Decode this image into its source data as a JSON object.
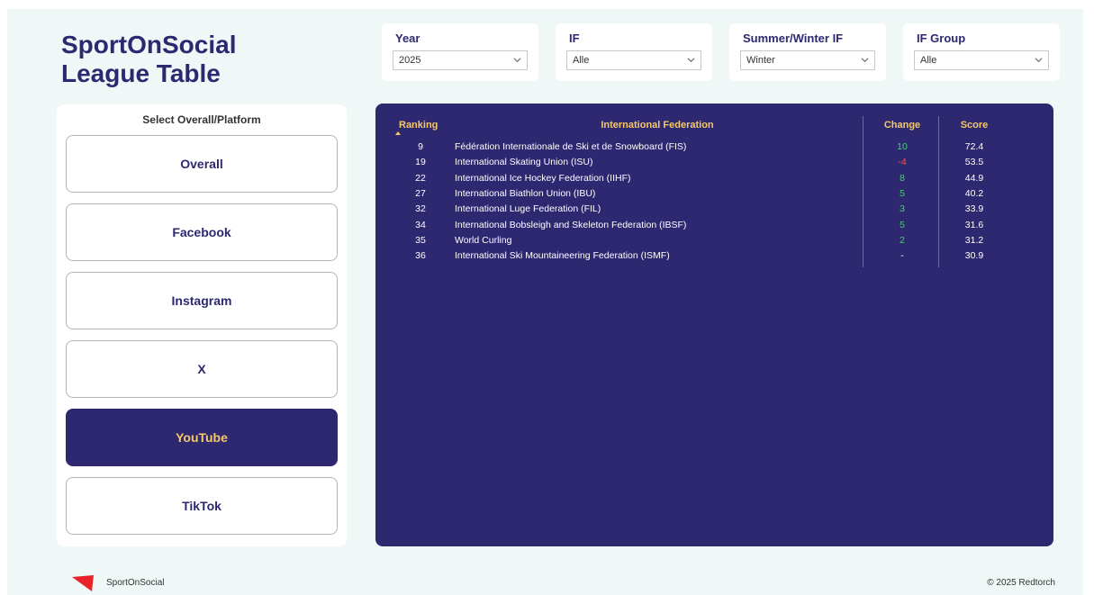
{
  "title": {
    "line1": "SportOnSocial",
    "line2": "League Table"
  },
  "filters": [
    {
      "label": "Year",
      "value": "2025"
    },
    {
      "label": "IF",
      "value": "Alle"
    },
    {
      "label": "Summer/Winter IF",
      "value": "Winter"
    },
    {
      "label": "IF Group",
      "value": "Alle"
    }
  ],
  "platform_panel": {
    "title": "Select Overall/Platform",
    "buttons": [
      {
        "label": "Overall",
        "active": false
      },
      {
        "label": "Facebook",
        "active": false
      },
      {
        "label": "Instagram",
        "active": false
      },
      {
        "label": "X",
        "active": false
      },
      {
        "label": "YouTube",
        "active": true
      },
      {
        "label": "TikTok",
        "active": false
      }
    ]
  },
  "table": {
    "headers": {
      "ranking": "Ranking",
      "federation": "International Federation",
      "change": "Change",
      "score": "Score"
    },
    "rows": [
      {
        "ranking": "9",
        "federation": "Fédération Internationale de Ski et de Snowboard (FIS)",
        "change": "10",
        "change_type": "pos",
        "score": "72.4"
      },
      {
        "ranking": "19",
        "federation": "International Skating Union (ISU)",
        "change": "-4",
        "change_type": "neg",
        "score": "53.5"
      },
      {
        "ranking": "22",
        "federation": "International Ice Hockey Federation (IIHF)",
        "change": "8",
        "change_type": "pos",
        "score": "44.9"
      },
      {
        "ranking": "27",
        "federation": "International Biathlon Union (IBU)",
        "change": "5",
        "change_type": "pos",
        "score": "40.2"
      },
      {
        "ranking": "32",
        "federation": "International Luge Federation (FIL)",
        "change": "3",
        "change_type": "pos",
        "score": "33.9"
      },
      {
        "ranking": "34",
        "federation": "International Bobsleigh and Skeleton Federation (IBSF)",
        "change": "5",
        "change_type": "pos",
        "score": "31.6"
      },
      {
        "ranking": "35",
        "federation": "World Curling",
        "change": "2",
        "change_type": "pos",
        "score": "31.2"
      },
      {
        "ranking": "36",
        "federation": "International Ski Mountaineering Federation (ISMF)",
        "change": "-",
        "change_type": "neu",
        "score": "30.9"
      }
    ]
  },
  "footer": {
    "brand": "SportOnSocial",
    "copyright": "© 2025 Redtorch"
  },
  "colors": {
    "primary": "#2d2870",
    "accent": "#f5c96a",
    "positive": "#3fd46b",
    "negative": "#ff4d4d",
    "background": "#f0f8f7",
    "logo": "#e8232a"
  }
}
